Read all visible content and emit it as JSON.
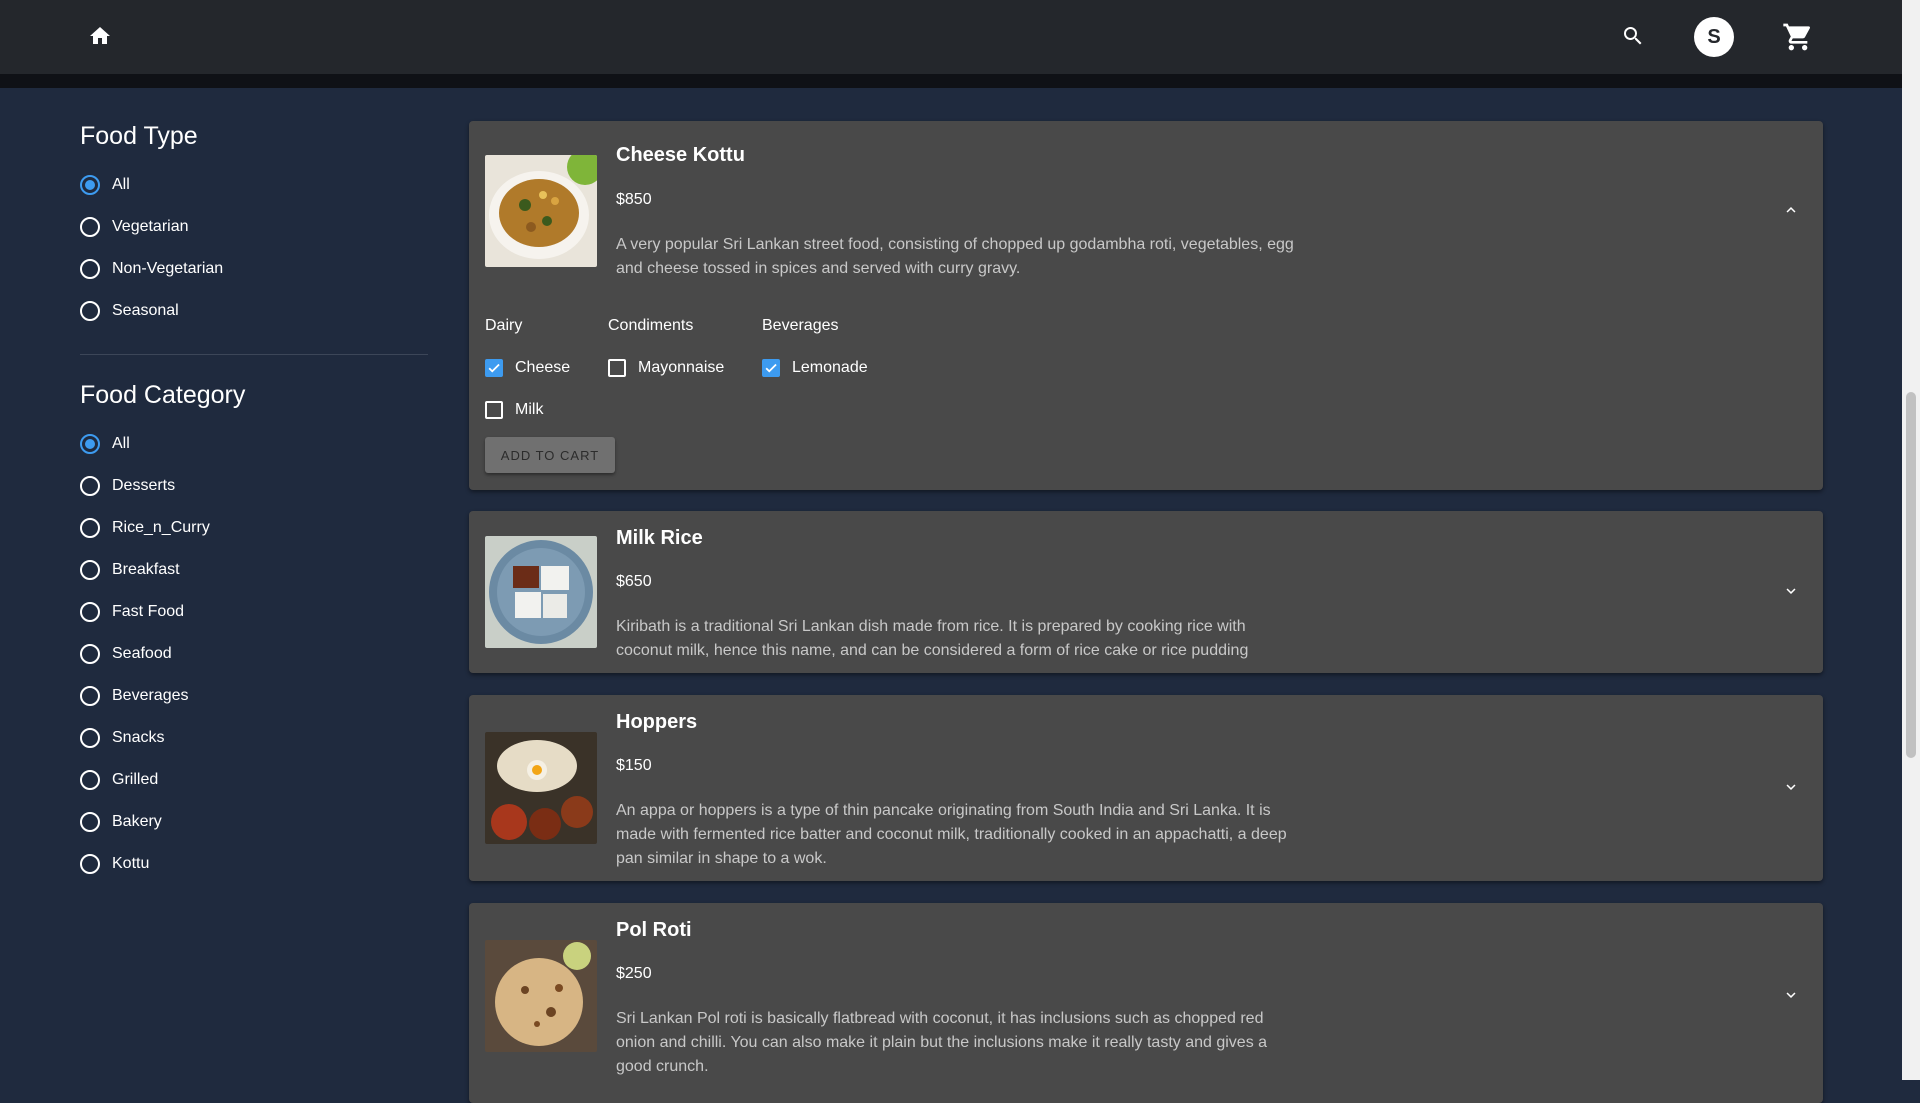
{
  "header": {
    "home_icon": "home-icon",
    "search_icon": "search-icon",
    "avatar_initial": "S",
    "cart_icon": "shopping-cart-icon"
  },
  "sidebar": {
    "food_type": {
      "title": "Food Type",
      "options": [
        "All",
        "Vegetarian",
        "Non-Vegetarian",
        "Seasonal"
      ],
      "selected": "All"
    },
    "food_category": {
      "title": "Food Category",
      "options": [
        "All",
        "Desserts",
        "Rice_n_Curry",
        "Breakfast",
        "Fast Food",
        "Seafood",
        "Beverages",
        "Snacks",
        "Grilled",
        "Bakery",
        "Kottu"
      ],
      "selected": "All"
    }
  },
  "items": [
    {
      "name": "Cheese Kottu",
      "price": "$850",
      "description": "A very popular Sri Lankan street food, consisting of chopped up godambha roti, vegetables, egg and cheese tossed in spices and served with curry gravy.",
      "expanded": true,
      "option_groups": [
        {
          "title": "Dairy",
          "options": [
            {
              "label": "Cheese",
              "checked": true
            },
            {
              "label": "Milk",
              "checked": false
            }
          ]
        },
        {
          "title": "Condiments",
          "options": [
            {
              "label": "Mayonnaise",
              "checked": false
            }
          ]
        },
        {
          "title": "Beverages",
          "options": [
            {
              "label": "Lemonade",
              "checked": true
            }
          ]
        }
      ],
      "add_to_cart_label": "ADD TO CART"
    },
    {
      "name": "Milk Rice",
      "price": "$650",
      "description": "Kiribath is a traditional Sri Lankan dish made from rice. It is prepared by cooking rice with coconut milk, hence this name, and can be considered a form of rice cake or rice pudding",
      "expanded": false
    },
    {
      "name": "Hoppers",
      "price": "$150",
      "description": "An appa or hoppers is a type of thin pancake originating from South India and Sri Lanka. It is made with fermented rice batter and coconut milk, traditionally cooked in an appachatti, a deep pan similar in shape to a wok.",
      "expanded": false
    },
    {
      "name": "Pol Roti",
      "price": "$250",
      "description": "Sri Lankan Pol roti is basically flatbread with coconut, it has inclusions such as chopped red onion and chilli. You can also make it plain but the inclusions make it really tasty and gives a good crunch.",
      "expanded": false
    }
  ],
  "colors": {
    "background": "#1f2a3e",
    "appbar": "#24272c",
    "card": "#494949",
    "accent": "#3d9bf0"
  }
}
